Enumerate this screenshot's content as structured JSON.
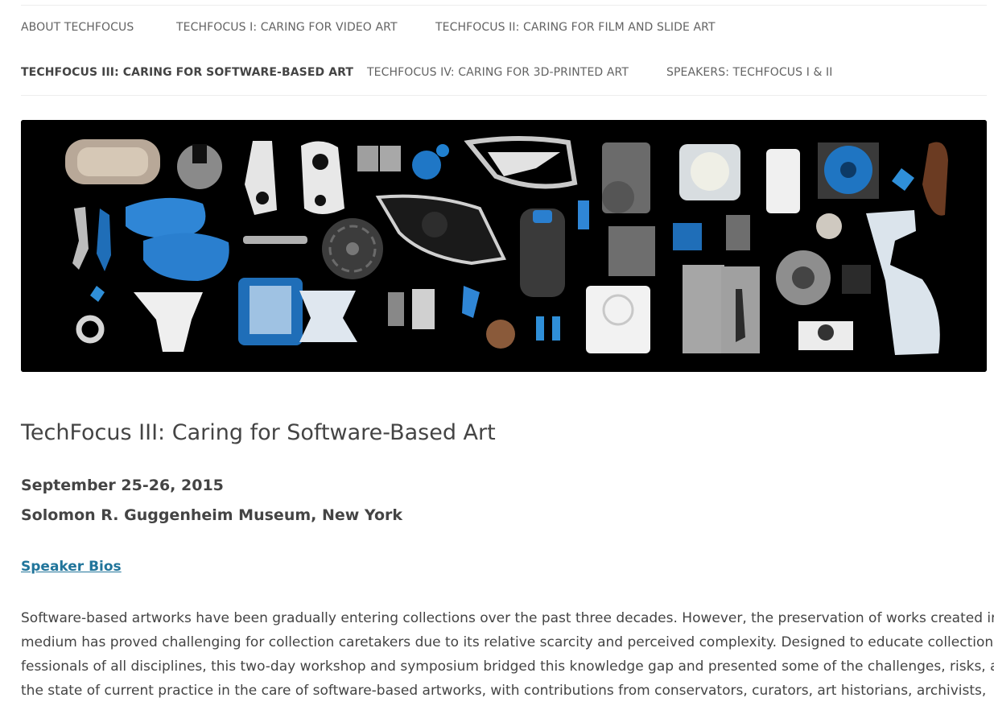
{
  "nav": {
    "items": [
      {
        "label": "ABOUT TECHFOCUS"
      },
      {
        "label": "TECHFOCUS I: CARING FOR VIDEO ART"
      },
      {
        "label": "TECHFOCUS II: CARING FOR FILM AND SLIDE ART"
      },
      {
        "label": "TECHFOCUS III: CARING FOR SOFTWARE-BASED ART",
        "current": true
      },
      {
        "label": "TECHFOCUS IV: CARING FOR 3D-PRINTED ART"
      },
      {
        "label": "SPEAKERS: TECHFOCUS I & II"
      }
    ]
  },
  "banner": {
    "background": "#000000",
    "accent_blue": "#2f8fd8",
    "object_icons": [
      "3d-printed-objects-photo"
    ]
  },
  "main": {
    "title": "TechFocus III: Caring for Software-Based Art",
    "date": "September 25-26, 2015",
    "venue": "Solomon R. Guggenheim Museum, New York",
    "speaker_link": "Speaker Bios",
    "body_lines": [
      "Software-based artworks have been gradually entering collections over the past three decades. However, the preservation of works created in this",
      "medium has proved challenging for collection caretakers due to its relative scarcity and perceived complexity. Designed to educate collection pro-",
      "fessionals of all disciplines, this two-day workshop and symposium bridged this knowledge gap and presented some of the challenges, risks, and",
      "the state of current practice in the care of software-based artworks, with contributions from conservators, curators, art historians, archivists,"
    ]
  },
  "colors": {
    "text": "#444444",
    "nav_text": "#636363",
    "link": "#21759b"
  }
}
